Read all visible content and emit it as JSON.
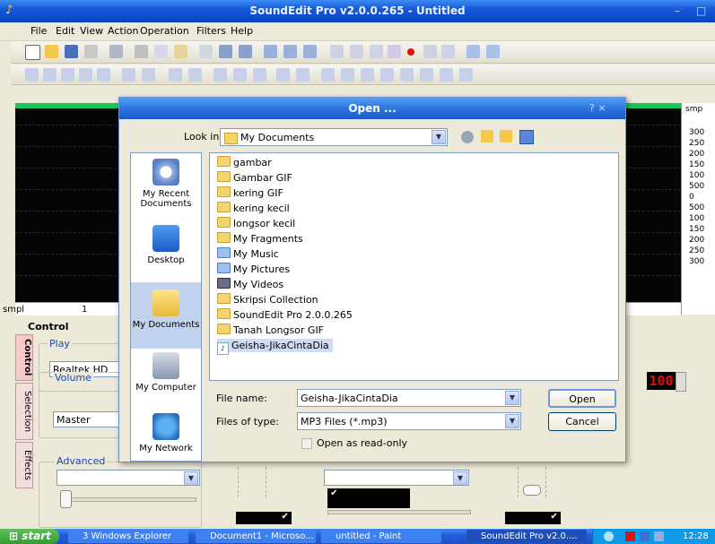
{
  "app": {
    "title": "SoundEdit Pro v2.0.0.265 - Untitled",
    "window_buttons": {
      "minimize": "–",
      "maximize": "□"
    }
  },
  "menu": [
    "File",
    "Edit",
    "View",
    "Action",
    "Operation",
    "Filters",
    "Help"
  ],
  "waveform": {
    "channel_label_left": "smpl",
    "ruler_tick": "1",
    "right_header": "smp",
    "scale": [
      "300",
      "250",
      "200",
      "150",
      "100",
      "500",
      "0",
      "500",
      "100",
      "150",
      "200",
      "250",
      "300"
    ]
  },
  "control": {
    "heading": "Control",
    "side_tabs": [
      "Control",
      "Selection",
      "Effects"
    ],
    "play_group": "Play",
    "device": "Realtek HD Aud",
    "volume_group": "Volume",
    "volume_source": "Master Volume",
    "advanced_group": "Advanced",
    "led_display": "100"
  },
  "dialog": {
    "title": "Open ...",
    "close": "?  ×",
    "look_in_label": "Look in:",
    "look_in_value": "My Documents",
    "places": [
      "My Recent Documents",
      "Desktop",
      "My Documents",
      "My Computer",
      "My Network"
    ],
    "files": [
      {
        "name": "gambar",
        "type": "folder"
      },
      {
        "name": "Gambar GIF",
        "type": "folder"
      },
      {
        "name": "kering  GIF",
        "type": "folder"
      },
      {
        "name": "kering kecil",
        "type": "folder"
      },
      {
        "name": "longsor kecil",
        "type": "folder"
      },
      {
        "name": "My Fragments",
        "type": "folder"
      },
      {
        "name": "My Music",
        "type": "folder"
      },
      {
        "name": "My Pictures",
        "type": "folder"
      },
      {
        "name": "My Videos",
        "type": "folder"
      },
      {
        "name": "Skripsi Collection",
        "type": "folder"
      },
      {
        "name": "SoundEdit Pro 2.0.0.265",
        "type": "folder"
      },
      {
        "name": "Tanah Longsor GIF",
        "type": "folder"
      },
      {
        "name": "Geisha-JikaCintaDia",
        "type": "mp3",
        "selected": true
      }
    ],
    "file_name_label": "File name:",
    "file_name_value": "Geisha-JikaCintaDia",
    "file_type_label": "Files of type:",
    "file_type_value": "MP3 Files (*.mp3)",
    "open_button": "Open",
    "cancel_button": "Cancel",
    "readonly_label": "Open as read-only"
  },
  "taskbar": {
    "start": "start",
    "tasks": [
      "3 Windows Explorer",
      "Document1 - Microso...",
      "untitled - Paint",
      "SoundEdit Pro v2.0...."
    ],
    "clock": "12:28"
  },
  "colors": {
    "accent": "#1659d6",
    "wave_green": "#16c65a",
    "led_red": "#e01010"
  }
}
